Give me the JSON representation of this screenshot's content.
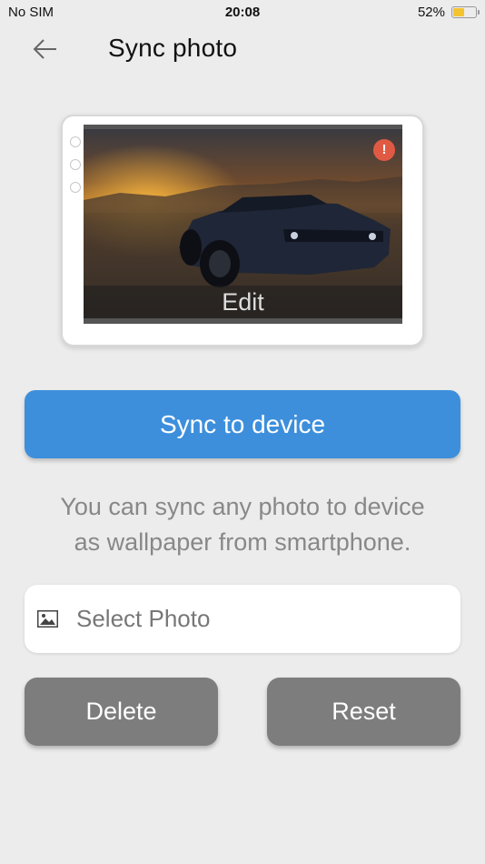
{
  "status_bar": {
    "carrier": "No SIM",
    "time": "20:08",
    "battery_percent": "52%",
    "battery_level": 0.52,
    "battery_color": "#f4c430"
  },
  "header": {
    "back_icon": "arrow-left-icon",
    "title": "Sync photo"
  },
  "preview": {
    "warning_icon": "exclamation-icon",
    "warning_symbol": "!",
    "warning_color": "#e05a43",
    "edit_label": "Edit"
  },
  "sync_button": {
    "label": "Sync to device",
    "color": "#3d8fdc"
  },
  "hint_lines": [
    "You can sync any photo to device",
    "as wallpaper from smartphone."
  ],
  "select_photo": {
    "icon": "image-icon",
    "label": "Select Photo"
  },
  "actions": {
    "delete_label": "Delete",
    "reset_label": "Reset",
    "button_color": "#7d7d7d"
  }
}
